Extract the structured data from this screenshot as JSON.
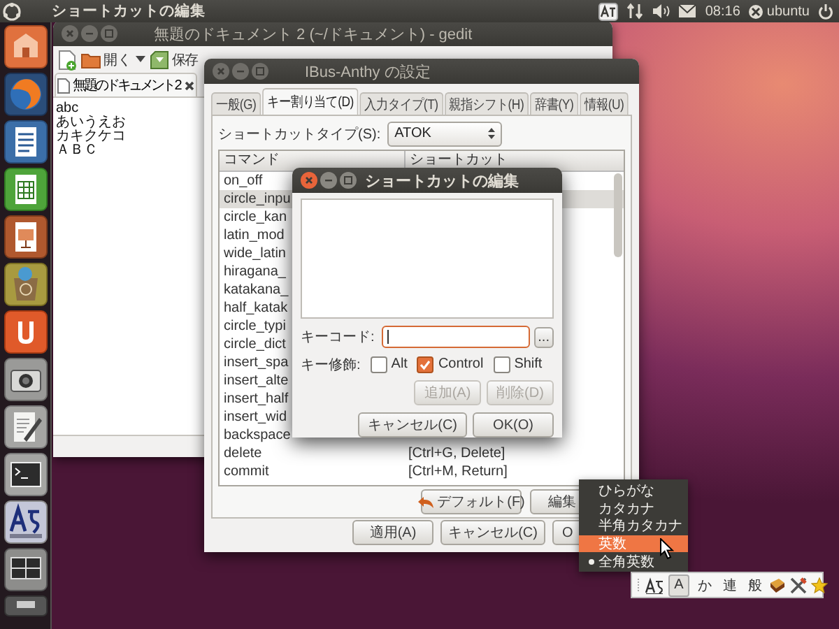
{
  "top_panel": {
    "title": "ショートカットの編集",
    "clock": "08:16",
    "user": "ubuntu"
  },
  "gedit": {
    "title": "無題のドキュメント 2 (~/ドキュメント) - gedit",
    "open": "開く",
    "save": "保存",
    "tab": "無題のドキュメント 2",
    "lines": [
      "abc",
      "あいうえお",
      "カキクケコ",
      "ＡＢＣ"
    ]
  },
  "ibus": {
    "title": "IBus-Anthy の設定",
    "tabs": [
      {
        "label": "一般(G)",
        "selected": false
      },
      {
        "label": "キー割り当て(D)",
        "selected": true
      },
      {
        "label": "入力タイプ(T)",
        "selected": false
      },
      {
        "label": "親指シフト(H)",
        "selected": false
      },
      {
        "label": "辞書(Y)",
        "selected": false
      },
      {
        "label": "情報(U)",
        "selected": false
      }
    ],
    "shortcut_type_label": "ショートカットタイプ(S):",
    "shortcut_type": "ATOK",
    "columns": [
      "コマンド",
      "ショートカット"
    ],
    "rows": [
      {
        "command": "on_off",
        "selected": false
      },
      {
        "command": "circle_inpu",
        "selected": true
      },
      {
        "command": "circle_kan",
        "selected": false
      },
      {
        "command": "latin_mod",
        "selected": false
      },
      {
        "command": "wide_latin",
        "selected": false
      },
      {
        "command": "hiragana_",
        "selected": false
      },
      {
        "command": "katakana_",
        "selected": false
      },
      {
        "command": "half_katak",
        "selected": false
      },
      {
        "command": "circle_typi",
        "selected": false
      },
      {
        "command": "circle_dict",
        "selected": false
      },
      {
        "command": "insert_spa",
        "selected": false
      },
      {
        "command": "insert_alte",
        "selected": false
      },
      {
        "command": "insert_half",
        "selected": false
      },
      {
        "command": "insert_wid",
        "selected": false
      },
      {
        "command": "backspace",
        "selected": false
      },
      {
        "command": "delete",
        "shortcut": "[Ctrl+G, Delete]",
        "selected": false
      },
      {
        "command": "commit",
        "shortcut": "[Ctrl+M, Return]",
        "selected": false
      }
    ],
    "list_buttons": [
      {
        "kind": "default",
        "label": "デフォルト(F)"
      },
      {
        "kind": "plain",
        "label": "編集"
      }
    ],
    "footer_buttons": [
      "適用(A)",
      "キャンセル(C)",
      "O"
    ]
  },
  "dialog": {
    "title": "ショートカットの編集",
    "keycode_label": "キーコード:",
    "browse": "...",
    "modifier_label": "キー修飾:",
    "modifiers": [
      {
        "label": "Alt",
        "checked": false
      },
      {
        "label": "Control",
        "checked": true
      },
      {
        "label": "Shift",
        "checked": false
      }
    ],
    "actions": [
      {
        "label": "追加(A)",
        "disabled": true
      },
      {
        "label": "削除(D)",
        "disabled": true
      }
    ],
    "buttons": [
      "キャンセル(C)",
      "OK(O)"
    ]
  },
  "input_menu": {
    "items": [
      {
        "label": "ひらがな",
        "highlighted": false,
        "checked": false
      },
      {
        "label": "カタカナ",
        "highlighted": false,
        "checked": false
      },
      {
        "label": "半角カタカナ",
        "highlighted": false,
        "checked": false
      },
      {
        "label": "英数",
        "highlighted": true,
        "checked": false
      },
      {
        "label": "全角英数",
        "highlighted": false,
        "checked": true
      }
    ]
  },
  "language_bar": {
    "items": [
      {
        "label": "A",
        "pressed": true
      },
      {
        "label": "か",
        "pressed": false
      },
      {
        "label": "連",
        "pressed": false
      },
      {
        "label": "般",
        "pressed": false
      }
    ]
  }
}
